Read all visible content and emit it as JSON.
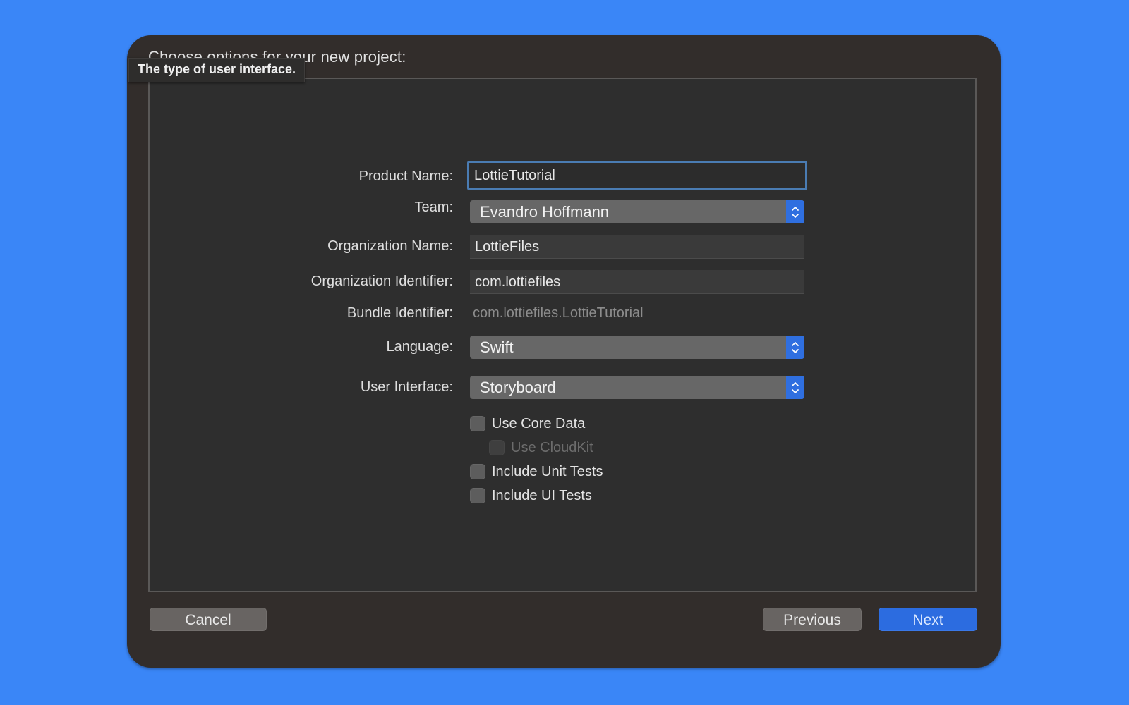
{
  "dialog": {
    "title": "Choose options for your new project:",
    "tooltip": "The type of user interface."
  },
  "form": {
    "product_name": {
      "label": "Product Name:",
      "value": "LottieTutorial"
    },
    "team": {
      "label": "Team:",
      "value": "Evandro Hoffmann"
    },
    "organization_name": {
      "label": "Organization Name:",
      "value": "LottieFiles"
    },
    "organization_identifier": {
      "label": "Organization Identifier:",
      "value": "com.lottiefiles"
    },
    "bundle_identifier": {
      "label": "Bundle Identifier:",
      "value": "com.lottiefiles.LottieTutorial"
    },
    "language": {
      "label": "Language:",
      "value": "Swift"
    },
    "user_interface": {
      "label": "User Interface:",
      "value": "Storyboard"
    },
    "checkboxes": [
      {
        "label": "Use Core Data",
        "checked": false,
        "enabled": true
      },
      {
        "label": "Use CloudKit",
        "checked": false,
        "enabled": false
      },
      {
        "label": "Include Unit Tests",
        "checked": false,
        "enabled": true
      },
      {
        "label": "Include UI Tests",
        "checked": false,
        "enabled": true
      }
    ]
  },
  "buttons": {
    "cancel": "Cancel",
    "previous": "Previous",
    "next": "Next"
  },
  "colors": {
    "background": "#3a86f7",
    "accent": "#2c6ce0",
    "focus_ring": "#4a7cb3"
  }
}
